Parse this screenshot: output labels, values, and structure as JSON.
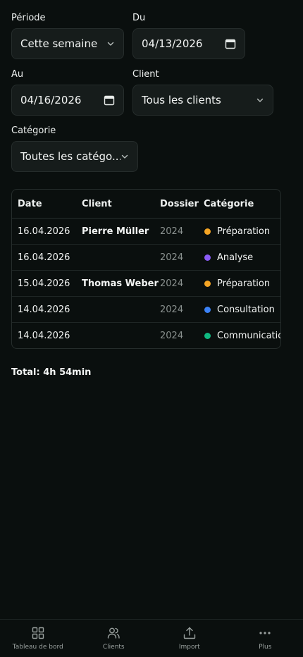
{
  "filters": {
    "periode": {
      "label": "Période",
      "value": "Cette semaine"
    },
    "du": {
      "label": "Du",
      "value": "04/13/2026"
    },
    "au": {
      "label": "Au",
      "value": "04/16/2026"
    },
    "client": {
      "label": "Client",
      "value": "Tous les clients"
    },
    "categorie": {
      "label": "Catégorie",
      "value": "Toutes les catégo..."
    }
  },
  "table": {
    "headers": [
      "Date",
      "Client",
      "Dossier",
      "Catégorie"
    ],
    "rows": [
      {
        "date": "16.04.2026",
        "client": "Pierre Müller",
        "dossier": "2024",
        "categorie": "Préparation",
        "color": "#f5a524"
      },
      {
        "date": "16.04.2026",
        "client": "",
        "dossier": "2024",
        "categorie": "Analyse",
        "color": "#8b5cf6"
      },
      {
        "date": "15.04.2026",
        "client": "Thomas Weber",
        "dossier": "2024",
        "categorie": "Préparation",
        "color": "#f5a524"
      },
      {
        "date": "14.04.2026",
        "client": "",
        "dossier": "2024",
        "categorie": "Consultation",
        "color": "#3b82f6"
      },
      {
        "date": "14.04.2026",
        "client": "",
        "dossier": "2024",
        "categorie": "Communication",
        "color": "#10b981"
      }
    ]
  },
  "total": "Total: 4h 54min",
  "nav": {
    "dashboard": "Tableau de bord",
    "clients": "Clients",
    "import": "Import",
    "more": "Plus"
  }
}
